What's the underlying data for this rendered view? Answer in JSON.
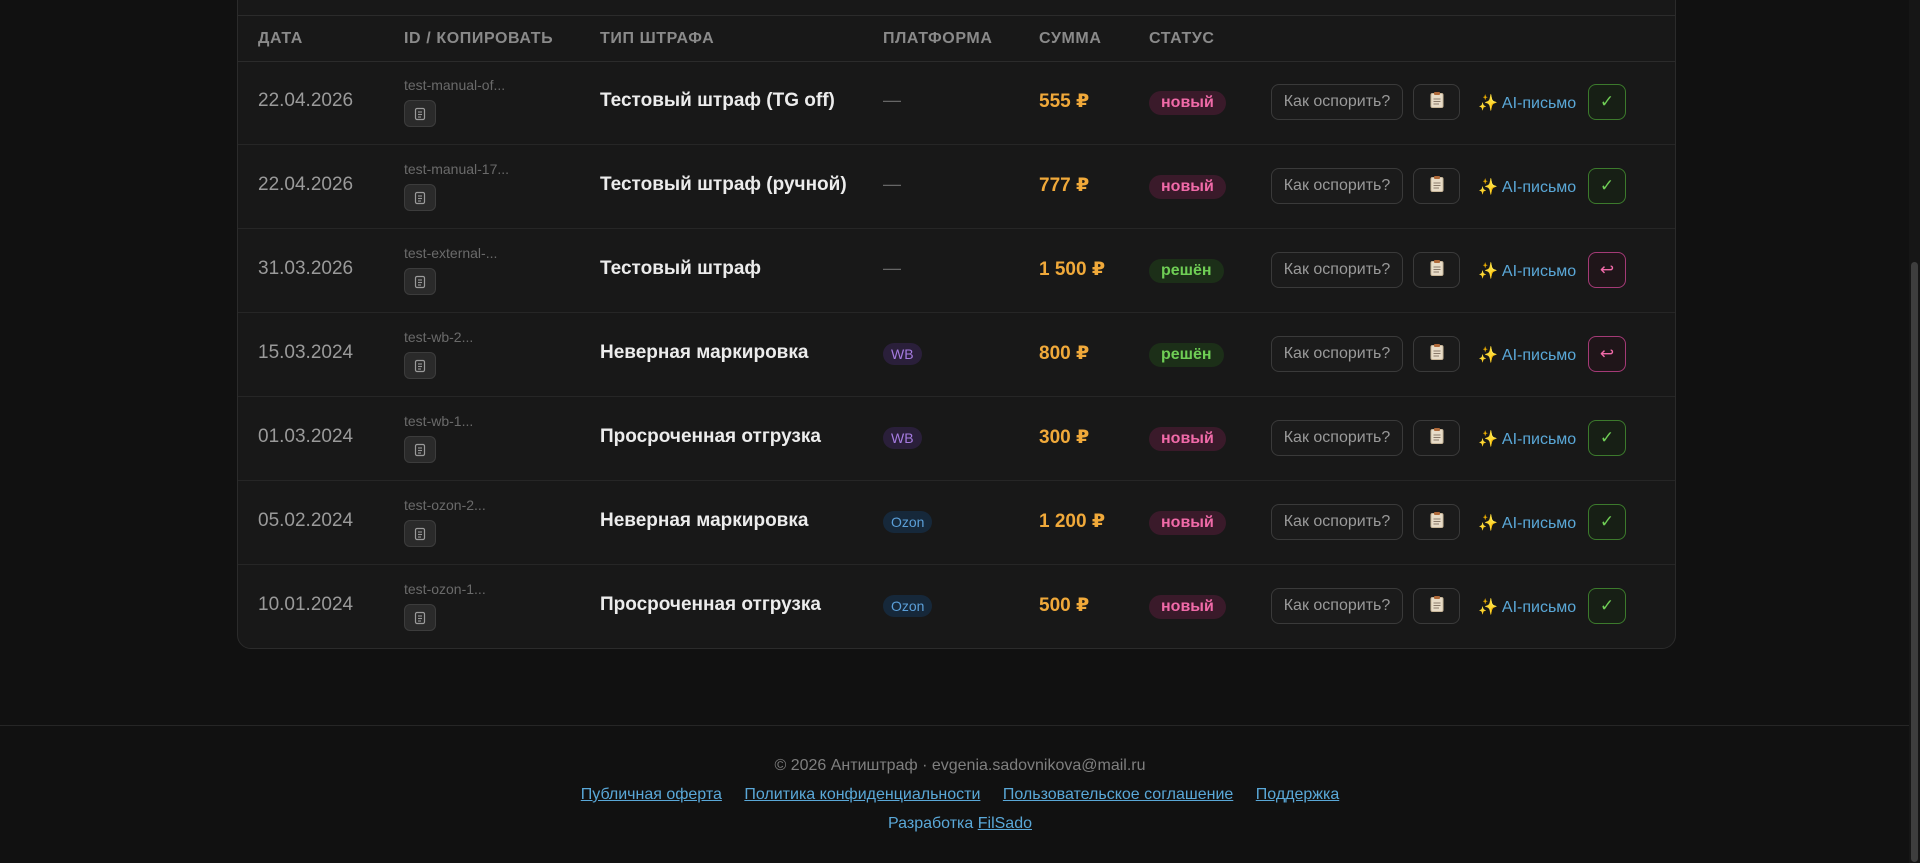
{
  "table": {
    "headers": {
      "date": "ДАТА",
      "id": "ID / КОПИРОВАТЬ",
      "type": "ТИП ШТРАФА",
      "platform": "ПЛАТФОРМА",
      "sum": "СУММА",
      "status": "СТАТУС"
    },
    "rows": [
      {
        "date": "22.04.2026",
        "id": "test-manual-of...",
        "type": "Тестовый штраф (TG off)",
        "platform": "—",
        "sum": "555 ₽",
        "status": "новый",
        "action": "✓"
      },
      {
        "date": "22.04.2026",
        "id": "test-manual-17...",
        "type": "Тестовый штраф (ручной)",
        "platform": "—",
        "sum": "777 ₽",
        "status": "новый",
        "action": "✓"
      },
      {
        "date": "31.03.2026",
        "id": "test-external-...",
        "type": "Тестовый штраф",
        "platform": "—",
        "sum": "1 500 ₽",
        "status": "решён",
        "action": "↩"
      },
      {
        "date": "15.03.2024",
        "id": "test-wb-2...",
        "type": "Неверная маркировка",
        "platform": "WB",
        "sum": "800 ₽",
        "status": "решён",
        "action": "↩"
      },
      {
        "date": "01.03.2024",
        "id": "test-wb-1...",
        "type": "Просроченная отгрузка",
        "platform": "WB",
        "sum": "300 ₽",
        "status": "новый",
        "action": "✓"
      },
      {
        "date": "05.02.2024",
        "id": "test-ozon-2...",
        "type": "Неверная маркировка",
        "platform": "Ozon",
        "sum": "1 200 ₽",
        "status": "новый",
        "action": "✓"
      },
      {
        "date": "10.01.2024",
        "id": "test-ozon-1...",
        "type": "Просроченная отгрузка",
        "platform": "Ozon",
        "sum": "500 ₽",
        "status": "новый",
        "action": "✓"
      }
    ],
    "dispute_label": "Как оспорить?",
    "ai_label": "AI-письмо"
  },
  "footer": {
    "copyright": "© 2026 Антиштраф · evgenia.sadovnikova@mail.ru",
    "links": [
      "Публичная оферта",
      "Политика конфиденциальности",
      "Пользовательское соглашение",
      "Поддержка"
    ],
    "dev_prefix": "Разработка",
    "dev_name": "FilSado"
  },
  "colors": {
    "background": "#111111",
    "card": "#181818",
    "sum": "#f0a93a",
    "status_new": "#f06aa8",
    "status_done": "#6fce55",
    "link": "#5aa8d8"
  },
  "icons": {
    "copy": "copy-icon",
    "doc": "clipboard-icon",
    "ai": "sparkles-icon",
    "ok": "check-icon",
    "return": "return-icon"
  }
}
